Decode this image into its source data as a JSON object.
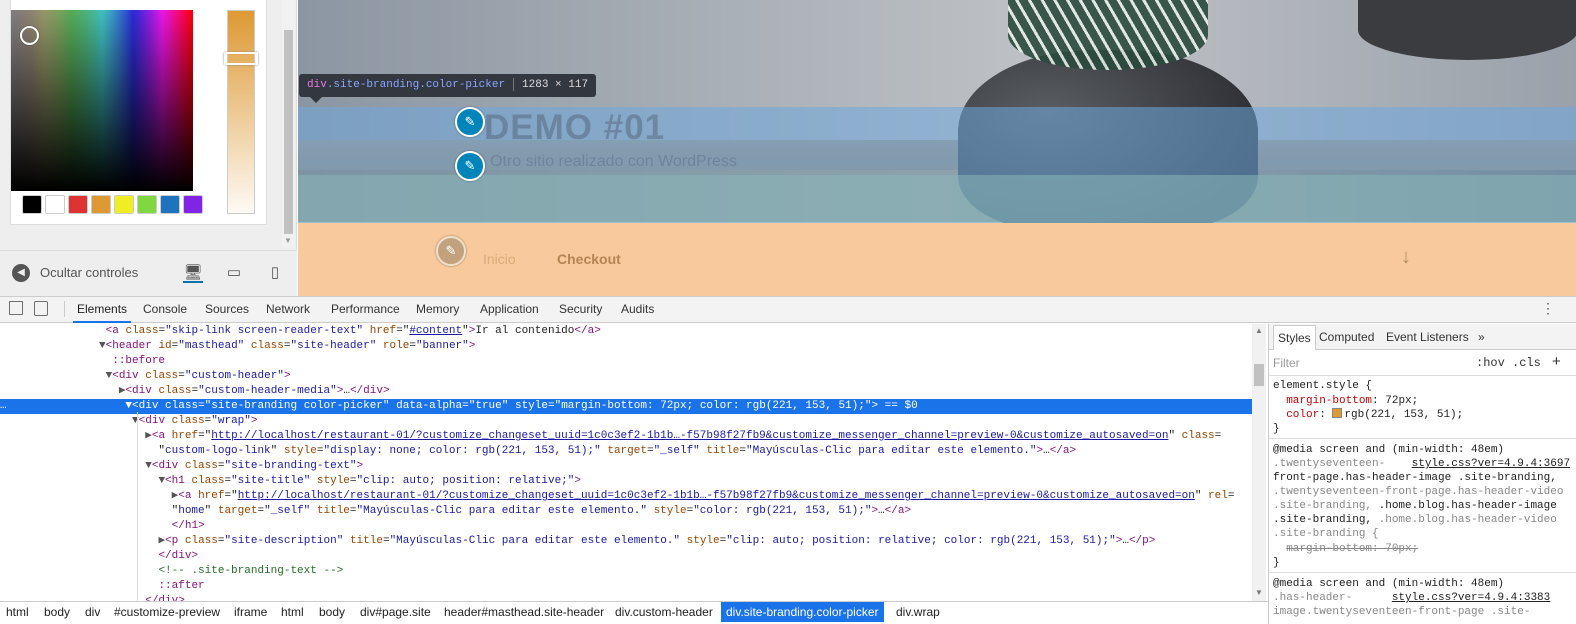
{
  "customizer": {
    "hide_controls_label": "Ocultar controles",
    "swatches": [
      "#000000",
      "#ffffff",
      "#dd3333",
      "#dd9933",
      "#eeee22",
      "#81d742",
      "#1e73be",
      "#8224e3"
    ],
    "selected_color": "#dd9933",
    "devices": [
      "desktop-icon",
      "tablet-icon",
      "mobile-icon"
    ]
  },
  "preview": {
    "site_title": "DEMO #01",
    "site_description": "Otro sitio realizado con WordPress",
    "nav": [
      "Inicio",
      "Checkout"
    ],
    "tooltip": {
      "tag": "div",
      "classes": ".site-branding.color-picker",
      "dims": "1283 × 117"
    }
  },
  "devtools": {
    "tabs": [
      "Elements",
      "Console",
      "Sources",
      "Network",
      "Performance",
      "Memory",
      "Application",
      "Security",
      "Audits"
    ],
    "active_tab": "Elements",
    "breadcrumbs": [
      "html",
      "body",
      "div",
      "#customize-preview",
      "iframe",
      "html",
      "body",
      "div#page.site",
      "header#masthead.site-header",
      "div.custom-header",
      "div.site-branding.color-picker",
      "div.wrap"
    ],
    "styles_tabs": [
      "Styles",
      "Computed",
      "Event Listeners",
      "»"
    ],
    "filter_placeholder": "Filter",
    "hov": ":hov",
    "cls": ".cls",
    "plus": "+",
    "dom": {
      "l1_t1": "<a ",
      "l1_a1": "class",
      "l1_v1": "\"skip-link screen-reader-text\"",
      "l1_a2": " href",
      "l1_u": "#content",
      "l1_txt": "Ir al contenido",
      "l1_t2": "</a>",
      "l2_t": "<header ",
      "l2_a1": "id",
      "l2_v1": "\"masthead\"",
      "l2_a2": " class",
      "l2_v2": "\"site-header\"",
      "l2_a3": " role",
      "l2_v3": "\"banner\"",
      "l3": "::before",
      "l4_a": "class",
      "l4_v": "\"custom-header\"",
      "l5_v": "\"custom-header-media\"",
      "l6_v1": "\"site-branding color-picker\"",
      "l6_a2": "data-alpha",
      "l6_v2": "\"true\"",
      "l6_v3": "\"margin-bottom: 72px; color: rgb(221, 153, 51);\"",
      "l6_eq": " == $0",
      "l7_v": "\"wrap\"",
      "l8_u": "http://localhost/restaurant-01/?customize_changeset_uuid=1c0c3ef2-1b1b…-f57b98f27fb9&customize_messenger_channel=preview-0&customize_autosaved=on",
      "l9_v1": "custom-logo-link",
      "l9_v2": "\"display: none; color: rgb(221, 153, 51);\"",
      "l9_v3": "\"_self\"",
      "l9_v4": "\"Mayúsculas-Clic para editar este elemento.\"",
      "l10_v": "\"site-branding-text\"",
      "l11_v1": "\"site-title\"",
      "l11_v2": "\"clip: auto; position: relative;\"",
      "l12_u": "http://localhost/restaurant-01/?customize_changeset_uuid=1c0c3ef2-1b1b…-f57b98f27fb9&customize_messenger_channel=preview-0&customize_autosaved=on",
      "l13_v1": "home",
      "l13_v2": "\"_self\"",
      "l13_v3": "\"Mayúsculas-Clic para editar este elemento.\"",
      "l13_v4": "\"color: rgb(221, 153, 51);\"",
      "l15_v1": "\"site-description\"",
      "l15_v2": "\"Mayúsculas-Clic para editar este elemento.\"",
      "l15_v3": "\"clip: auto; position: relative; color: rgb(221, 153, 51);\"",
      "l17": "<!-- .site-branding-text -->",
      "l18": "::after"
    },
    "styles": {
      "s1": "element.style {",
      "s2_p": "margin-bottom",
      "s2_v": " 72px;",
      "s3_p": "color",
      "s3_v": "rgb(221, 153, 51);",
      "close": "}",
      "m1": "@media screen and (min-width: 48em)",
      "m1_l1": ".twentyseventeen-",
      "m1_link": "style.css?ver=4.9.4:3697",
      "m1_l2": "front-page.has-header-image .site-branding,",
      "m1_l3": ".twentyseventeen-front-page.has-header-video",
      "m1_l4": ".site-branding, ",
      "m1_l4b": ".home.blog.has-header-image",
      "m1_l5": ".site-branding, ",
      "m1_l5b": ".home.blog.has-header-video",
      "m1_l6": ".site-branding {",
      "m1_strike": "margin-bottom: 70px;",
      "m2": "@media screen and (min-width: 48em)",
      "m2_l1": ".has-header-",
      "m2_link": "style.css?ver=4.9.4:3383",
      "m2_l2": "image.twentyseventeen-front-page .site-"
    }
  }
}
